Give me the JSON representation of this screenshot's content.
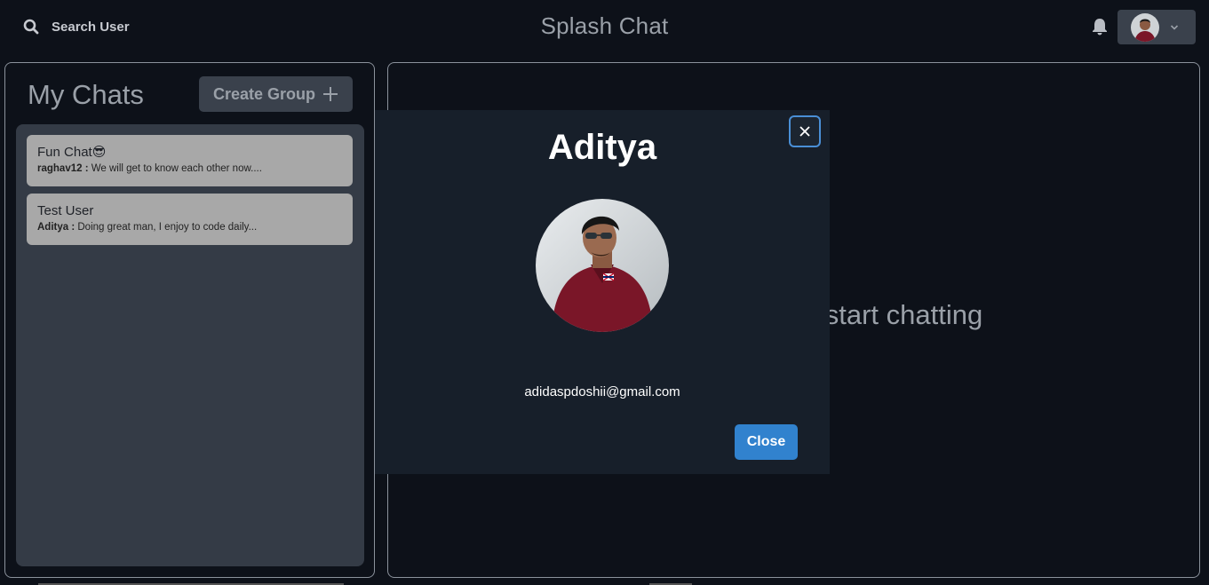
{
  "header": {
    "search_label": "Search User",
    "app_title": "Splash Chat",
    "search_icon": "search-icon",
    "bell_icon": "bell-icon",
    "profile_chevron_icon": "chevron-down-icon"
  },
  "chats": {
    "title": "My Chats",
    "create_group_label": "Create Group",
    "create_group_icon": "plus-icon",
    "items": [
      {
        "name": "Fun Chat😎",
        "sender": "raghav12 :",
        "message": "We will get to know each other now...."
      },
      {
        "name": "Test User",
        "sender": "Aditya :",
        "message": "Doing great man, I enjoy to code daily..."
      }
    ]
  },
  "chat_area": {
    "placeholder": "start chatting"
  },
  "modal": {
    "title": "Aditya",
    "email": "adidaspdoshii@gmail.com",
    "close_label": "Close",
    "close_icon": "close-icon"
  },
  "colors": {
    "background": "#0d1119",
    "panel": "#343b46",
    "modal": "#171f2a",
    "accent": "#3182ce"
  }
}
